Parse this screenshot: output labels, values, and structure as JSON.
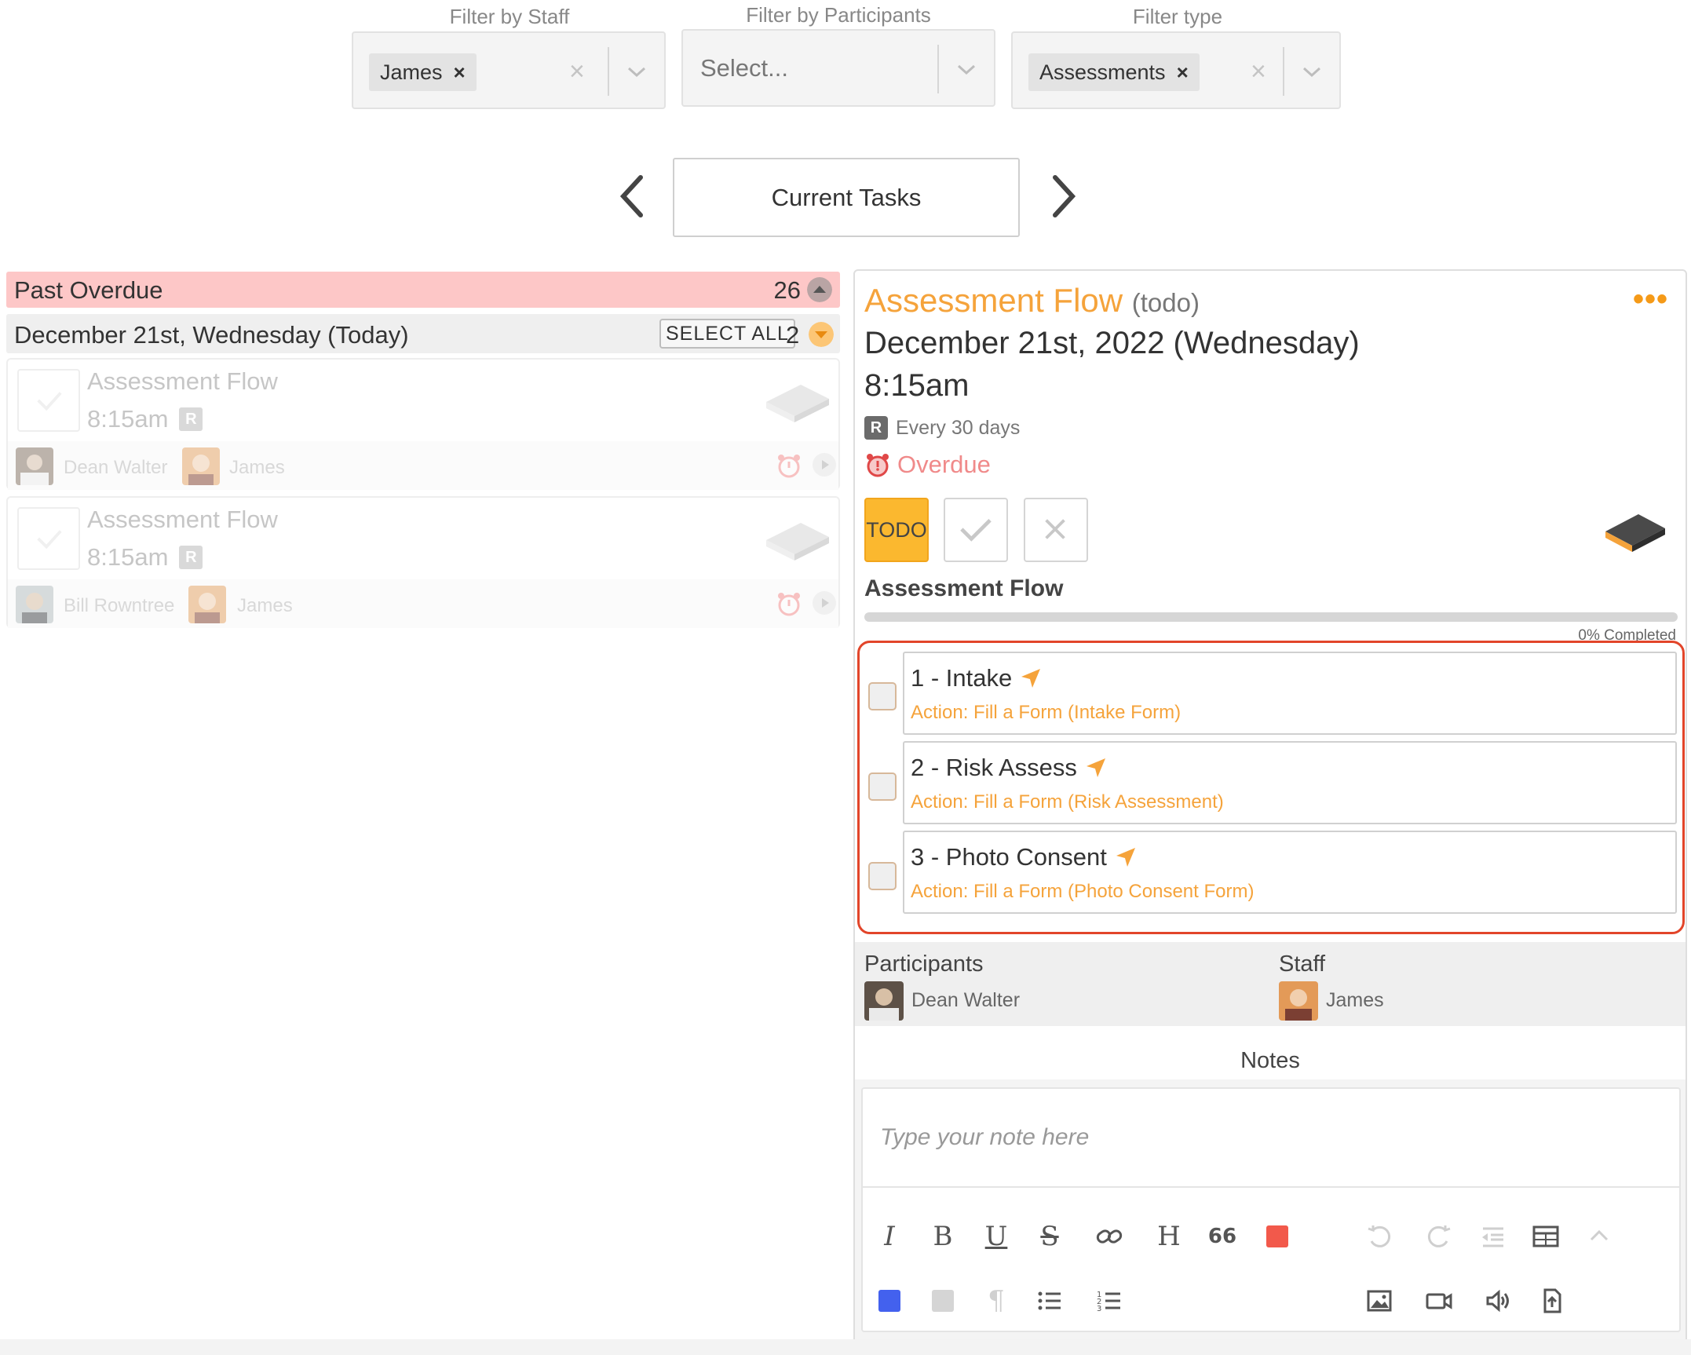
{
  "filters": {
    "staff": {
      "label": "Filter by Staff",
      "chip": "James"
    },
    "participants": {
      "label": "Filter by Participants",
      "placeholder": "Select..."
    },
    "type": {
      "label": "Filter type",
      "chip": "Assessments"
    }
  },
  "nav": {
    "current": "Current Tasks"
  },
  "list": {
    "past_overdue": {
      "label": "Past Overdue",
      "count": "26"
    },
    "today": {
      "label": "December 21st, Wednesday (Today)",
      "select_all": "SELECT ALL",
      "count": "2"
    },
    "tasks": [
      {
        "title": "Assessment Flow",
        "time": "8:15am",
        "badge": "R",
        "participant": "Dean Walter",
        "staff": "James"
      },
      {
        "title": "Assessment Flow",
        "time": "8:15am",
        "badge": "R",
        "participant": "Bill Rowntree",
        "staff": "James"
      }
    ]
  },
  "detail": {
    "title": "Assessment Flow",
    "status_tag": "(todo)",
    "date": "December 21st, 2022 (Wednesday)",
    "time": "8:15am",
    "repeat_badge": "R",
    "repeat": "Every 30 days",
    "overdue": "Overdue",
    "todo_label": "TODO",
    "flow_name": "Assessment Flow",
    "progress_text": "0% Completed",
    "progress_percent": 0,
    "steps": [
      {
        "name": "1 - Intake",
        "action": "Action: Fill a Form (Intake Form)"
      },
      {
        "name": "2 - Risk Assess",
        "action": "Action: Fill a Form (Risk Assessment)"
      },
      {
        "name": "3 - Photo Consent",
        "action": "Action: Fill a Form (Photo Consent Form)"
      }
    ],
    "participants_label": "Participants",
    "participant_name": "Dean Walter",
    "staff_label": "Staff",
    "staff_name": "James",
    "notes_label": "Notes",
    "note_placeholder": "Type your note here",
    "quote_label": "66"
  },
  "colors": {
    "accent": "#f5a33b",
    "overdue_bg": "#fdc7c7",
    "todo": "#fbb82f",
    "highlight_frame": "#e2452a",
    "red_swatch": "#f2594b",
    "blue_swatch": "#4361ee",
    "gray_swatch": "#d5d5d5"
  }
}
